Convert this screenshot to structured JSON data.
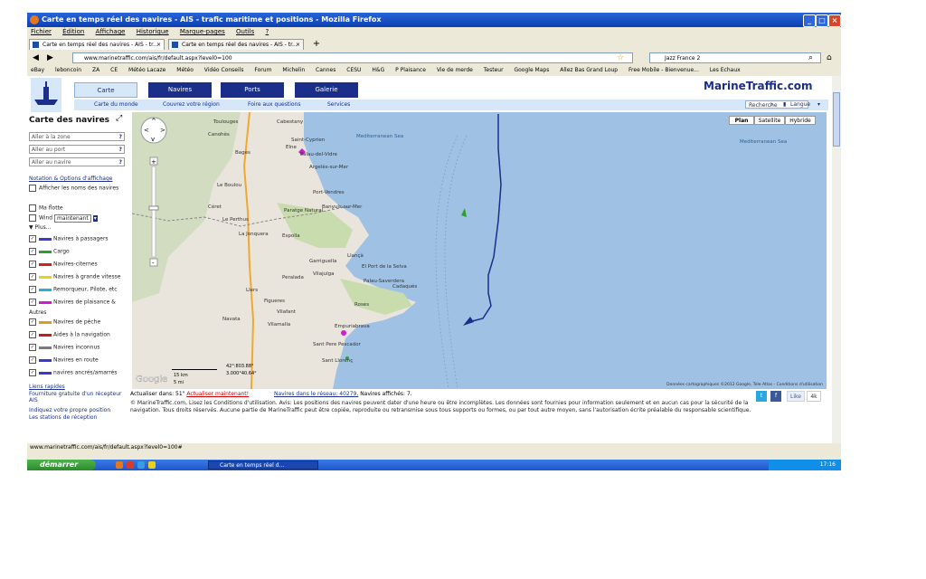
{
  "window": {
    "title": "Carte en temps réel des navires - AIS - trafic maritime et positions - Mozilla Firefox"
  },
  "menu": [
    "Fichier",
    "Édition",
    "Affichage",
    "Historique",
    "Marque-pages",
    "Outils",
    "?"
  ],
  "tabs": [
    {
      "label": "Carte en temps réel des navires - AIS - tr..."
    },
    {
      "label": "Carte en temps réel des navires - AIS - tr..."
    }
  ],
  "navbar": {
    "url": "www.marinetraffic.com/ais/fr/default.aspx?level0=100",
    "search": "Jazz France 2"
  },
  "bookmarks": [
    "eBay",
    "leboncoin",
    "ZA",
    "CE",
    "Météo Lacaze",
    "Météo",
    "Vidéo Conseils",
    "Forum",
    "Michelin",
    "Cannes",
    "CESU",
    "H&G",
    "P Plaisance",
    "Vie de merde",
    "Testeur",
    "Google Maps",
    "Allez Bas Grand Loup",
    "Free Mobile - Bienvenue...",
    "Les Echaux"
  ],
  "site": {
    "brand": "MarineTraffic.com",
    "nav_tabs": [
      "Carte",
      "Navires",
      "Ports",
      "Galerie"
    ],
    "subnav": [
      "Carte du monde",
      "Couvrez votre région",
      "Foire aux questions",
      "Services"
    ],
    "search_placeholder": "Recherche",
    "language": "Langue"
  },
  "sidebar": {
    "title": "Carte des navires",
    "inputs": [
      "Aller à la zone",
      "Aller au port",
      "Aller au navire"
    ],
    "options_link": "Notation & Options d'affichage",
    "show_names": "Afficher les noms des navires",
    "my_fleet": "Ma flotte",
    "wind": "Wind",
    "wind_value": "maintenant",
    "more": "Plus...",
    "vessel_types": [
      {
        "label": "Navires à passagers",
        "color": "#3a3acf"
      },
      {
        "label": "Cargo",
        "color": "#2e9e2e"
      },
      {
        "label": "Navires-citernes",
        "color": "#d22020"
      },
      {
        "label": "Navires à grande vitesse",
        "color": "#e6d21a"
      },
      {
        "label": "Remorqueur, Pilote, etc",
        "color": "#22b6c8"
      },
      {
        "label": "Navires de plaisance &",
        "color": "#d01cd0"
      }
    ],
    "others_label": "Autres",
    "other_types": [
      {
        "label": "Navires de pêche",
        "color": "#d8a020"
      },
      {
        "label": "Aides à la navigation",
        "color": "#c81c1c"
      },
      {
        "label": "Navires inconnus",
        "color": "#7a7a7a"
      },
      {
        "label": "Navires en route",
        "color": "#3a3acf"
      },
      {
        "label": "navires ancrés/amarrés",
        "color": "#3a3acf"
      }
    ],
    "links": [
      "Liens rapides",
      "Fourniture gratuite d'un récepteur AIS",
      "Indiquez votre propre position",
      "Les stations de réception"
    ]
  },
  "map": {
    "types": [
      "Plan",
      "Satellite",
      "Hybride"
    ],
    "sea_label_1": "Mediterranean Sea",
    "sea_label_2": "Mediterranean Sea",
    "places": [
      "Toulouges",
      "Cabestany",
      "Canohès",
      "Saint-Cyprien",
      "Elne",
      "Palau-del-Vidre",
      "Argelès-sur-Mer",
      "Bages",
      "Le Boulou",
      "Port-Vendres",
      "Banyuls-sur-Mer",
      "Céret",
      "Le Perthus",
      "La Jonquera",
      "Espolla",
      "Llançà",
      "El Port de la Selva",
      "Garriguella",
      "Vilajuïga",
      "Palau-Saverdera",
      "Cadaqués",
      "Peralada",
      "Llers",
      "Figueres",
      "Vilafant",
      "Roses",
      "Navata",
      "Vilamalla",
      "Sant Pere Pescador",
      "Empuriabrava",
      "Paratge Natural",
      "Sant Llorenç"
    ],
    "scale_km": "15 km",
    "scale_mi": "5 mi",
    "coords": "42°:803.88°",
    "coords2": "3.000°40.64°",
    "attribution": "Données cartographiques ©2012 Google, Tele Atlas - Conditions d'utilisation",
    "google": "Google"
  },
  "status": {
    "updated_prefix": "Actualiser dans: 51\"",
    "update_now": "Actualiser maintenant!",
    "network": "Navires dans le réseau: 40279,",
    "shown": "Navires affichés: 7."
  },
  "disclaimer": "© MarineTraffic.com,  Lisez les Conditions d'utilisation. Avis: Les positions des navires peuvent dater d'une heure ou être incomplètes. Les données sont fournies pour information seulement et en aucun cas pour la sécurité de la navigation. Tous droits réservés. Aucune partie de MarineTraffic peut être copiée, reproduite ou retransmise sous tous supports ou formes, ou par tout autre moyen, sans l'autorisation écrite préalable du responsable scientifique.",
  "social": {
    "like": "Like",
    "count": "4k"
  },
  "statusbar": "www.marinetraffic.com/ais/fr/default.aspx?level0=100#",
  "taskbar": {
    "start": "démarrer",
    "item": "Carte en temps réel d...",
    "clock": "17:16"
  }
}
